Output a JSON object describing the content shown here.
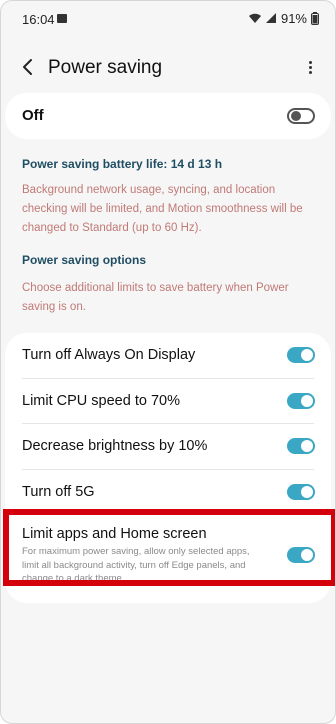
{
  "status_bar": {
    "time": "16:04",
    "battery": "91%"
  },
  "header": {
    "title": "Power saving"
  },
  "master_toggle": {
    "label": "Off",
    "state": "off"
  },
  "battery_life": "Power saving battery life: 14 d 13 h",
  "battery_life_desc": "Background network usage, syncing, and location checking will be limited, and Motion smoothness will be changed to Standard (up to 60 Hz).",
  "options_heading": "Power saving options",
  "options_desc": "Choose additional limits to save battery when Power saving is on.",
  "options": [
    {
      "label": "Turn off Always On Display",
      "state": "on"
    },
    {
      "label": "Limit CPU speed to 70%",
      "state": "on"
    },
    {
      "label": "Decrease brightness by 10%",
      "state": "on"
    },
    {
      "label": "Turn off 5G",
      "state": "on"
    },
    {
      "label": "Limit apps and Home screen",
      "description": "For maximum power saving, allow only selected apps, limit all background activity, turn off Edge panels, and change to a dark theme.",
      "state": "on"
    }
  ],
  "colors": {
    "accent": "#3aa7c4",
    "highlight": "#d4000c",
    "heading": "#1f4e63",
    "description": "#c07a76"
  }
}
